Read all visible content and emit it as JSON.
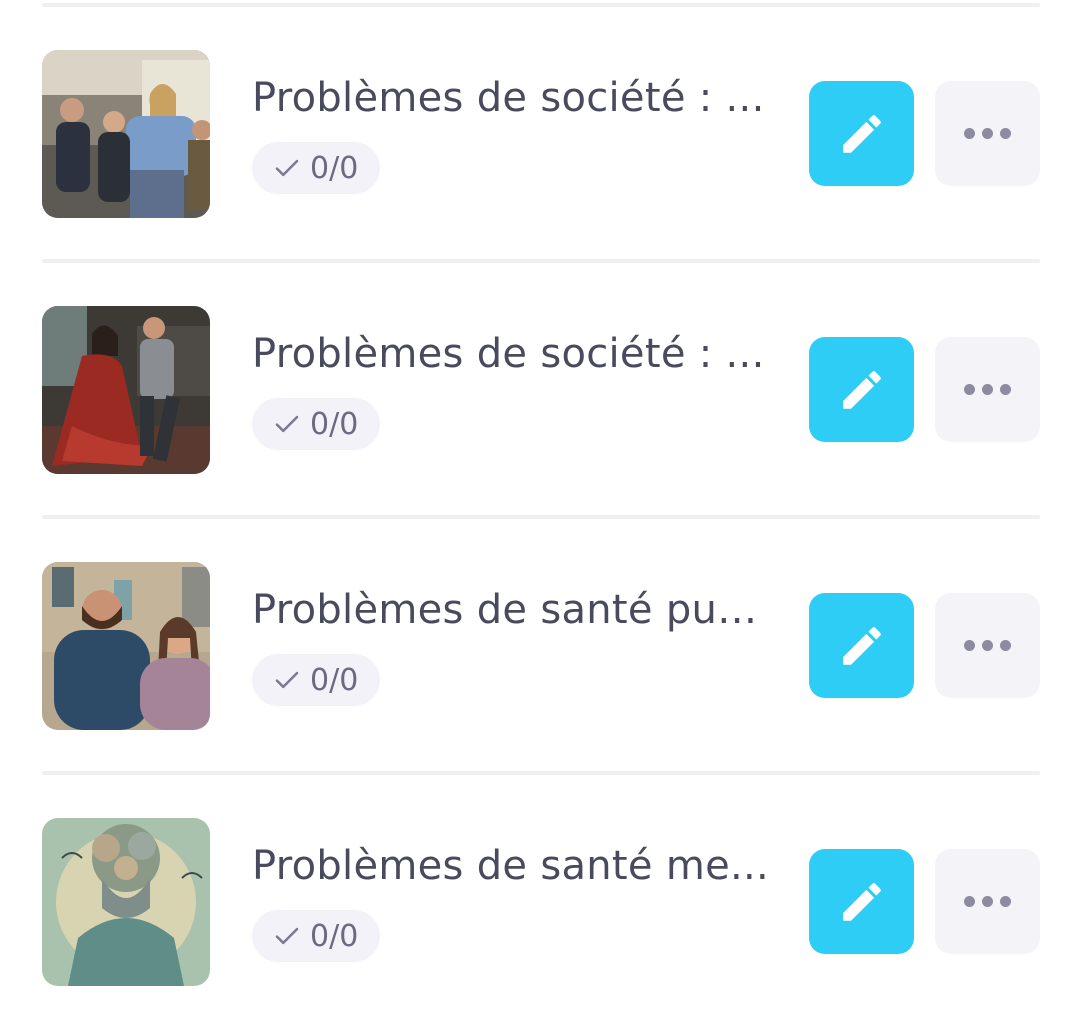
{
  "items": [
    {
      "title": "Problèmes de société : ...",
      "progress": "0/0",
      "thumbnail": "students-fighting-hallway-photo",
      "edit_icon": "pencil-icon",
      "more_icon": "more-horizontal-icon"
    },
    {
      "title": "Problèmes de société : ...",
      "progress": "0/0",
      "thumbnail": "domestic-dispute-kitchen-photo",
      "edit_icon": "pencil-icon",
      "more_icon": "more-horizontal-icon"
    },
    {
      "title": "Problèmes de santé pub...",
      "progress": "0/0",
      "thumbnail": "couple-street-photo",
      "edit_icon": "pencil-icon",
      "more_icon": "more-horizontal-icon"
    },
    {
      "title": "Problèmes de santé me...",
      "progress": "0/0",
      "thumbnail": "brain-illustration",
      "edit_icon": "pencil-icon",
      "more_icon": "more-horizontal-icon"
    }
  ],
  "colors": {
    "edit_button": "#2ecdf6",
    "more_button": "#f4f3f8",
    "title_text": "#4a4a5e",
    "badge_bg": "#f3f2f8"
  }
}
